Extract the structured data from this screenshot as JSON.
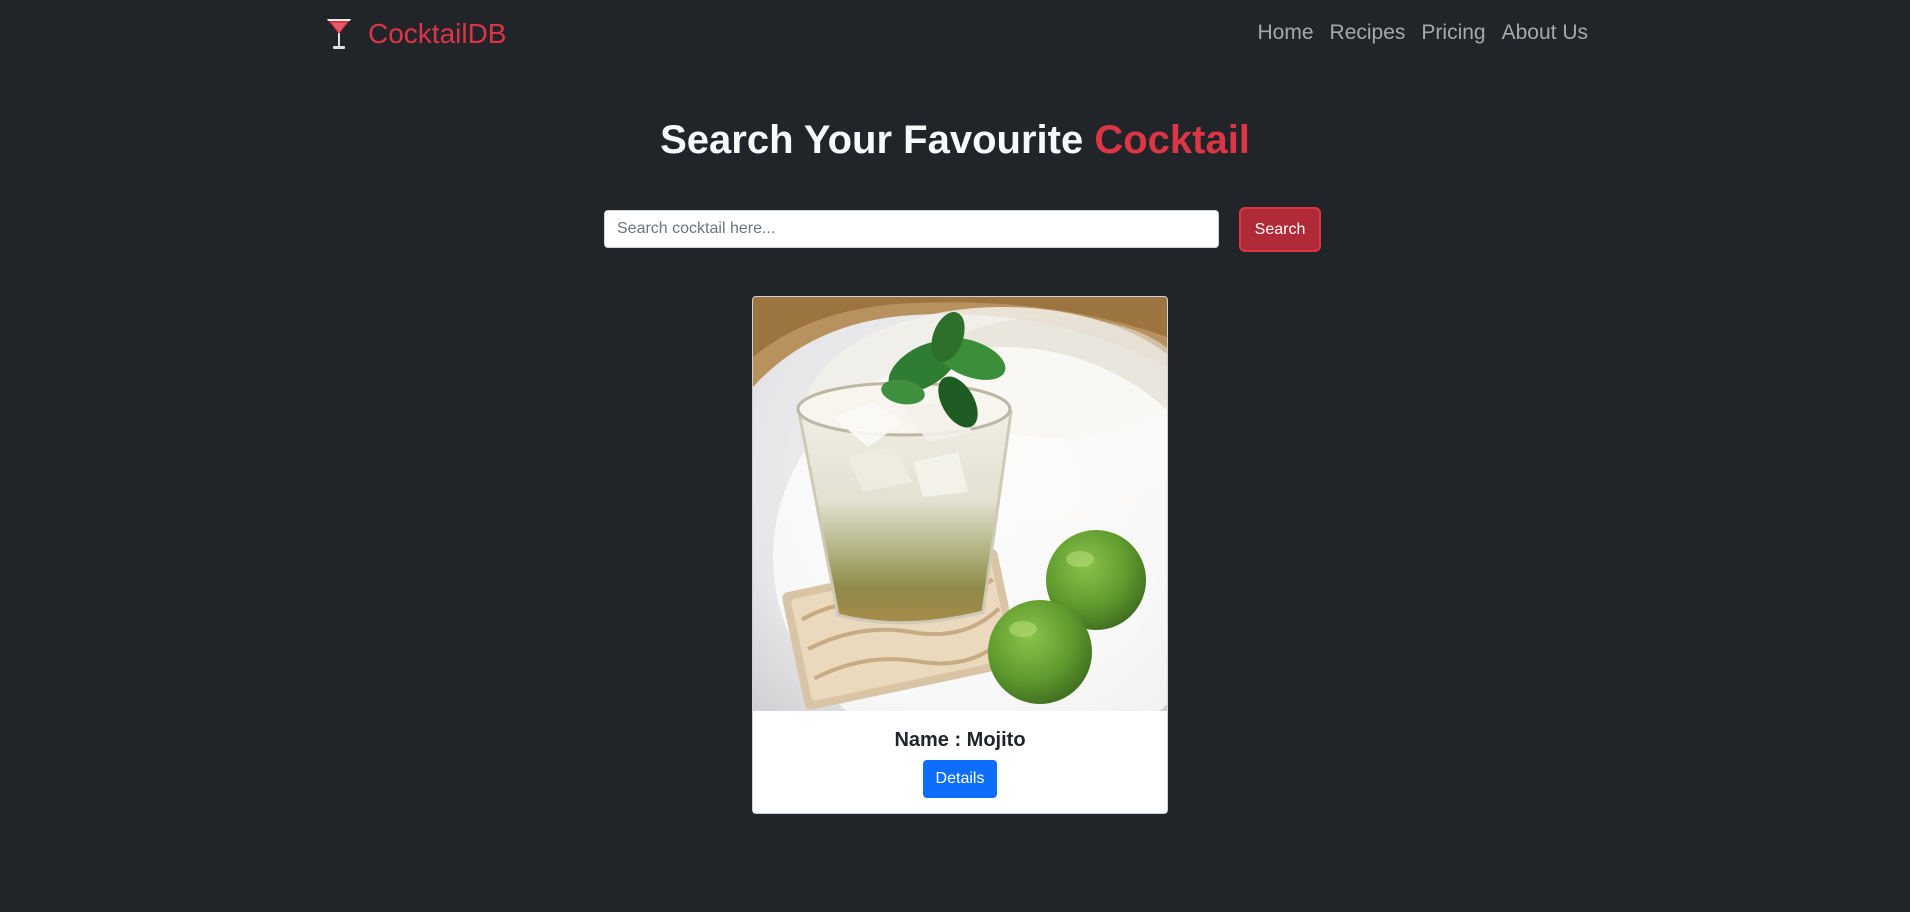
{
  "navbar": {
    "brand": {
      "name": "CocktailDB",
      "icon": "cocktail-glass-icon",
      "color": "#dc3545"
    },
    "links": [
      {
        "label": "Home"
      },
      {
        "label": "Recipes"
      },
      {
        "label": "Pricing"
      },
      {
        "label": "About Us"
      }
    ]
  },
  "hero": {
    "heading_prefix": "Search Your Favourite",
    "heading_accent": "Cocktail"
  },
  "search": {
    "placeholder": "Search cocktail here...",
    "value": "",
    "button_label": "Search"
  },
  "results": [
    {
      "title": "Name : Mojito",
      "button_label": "Details",
      "image": "mojito-photo"
    }
  ],
  "colors": {
    "background": "#212529",
    "accent": "#dc3545",
    "primary": "#0d6efd"
  }
}
